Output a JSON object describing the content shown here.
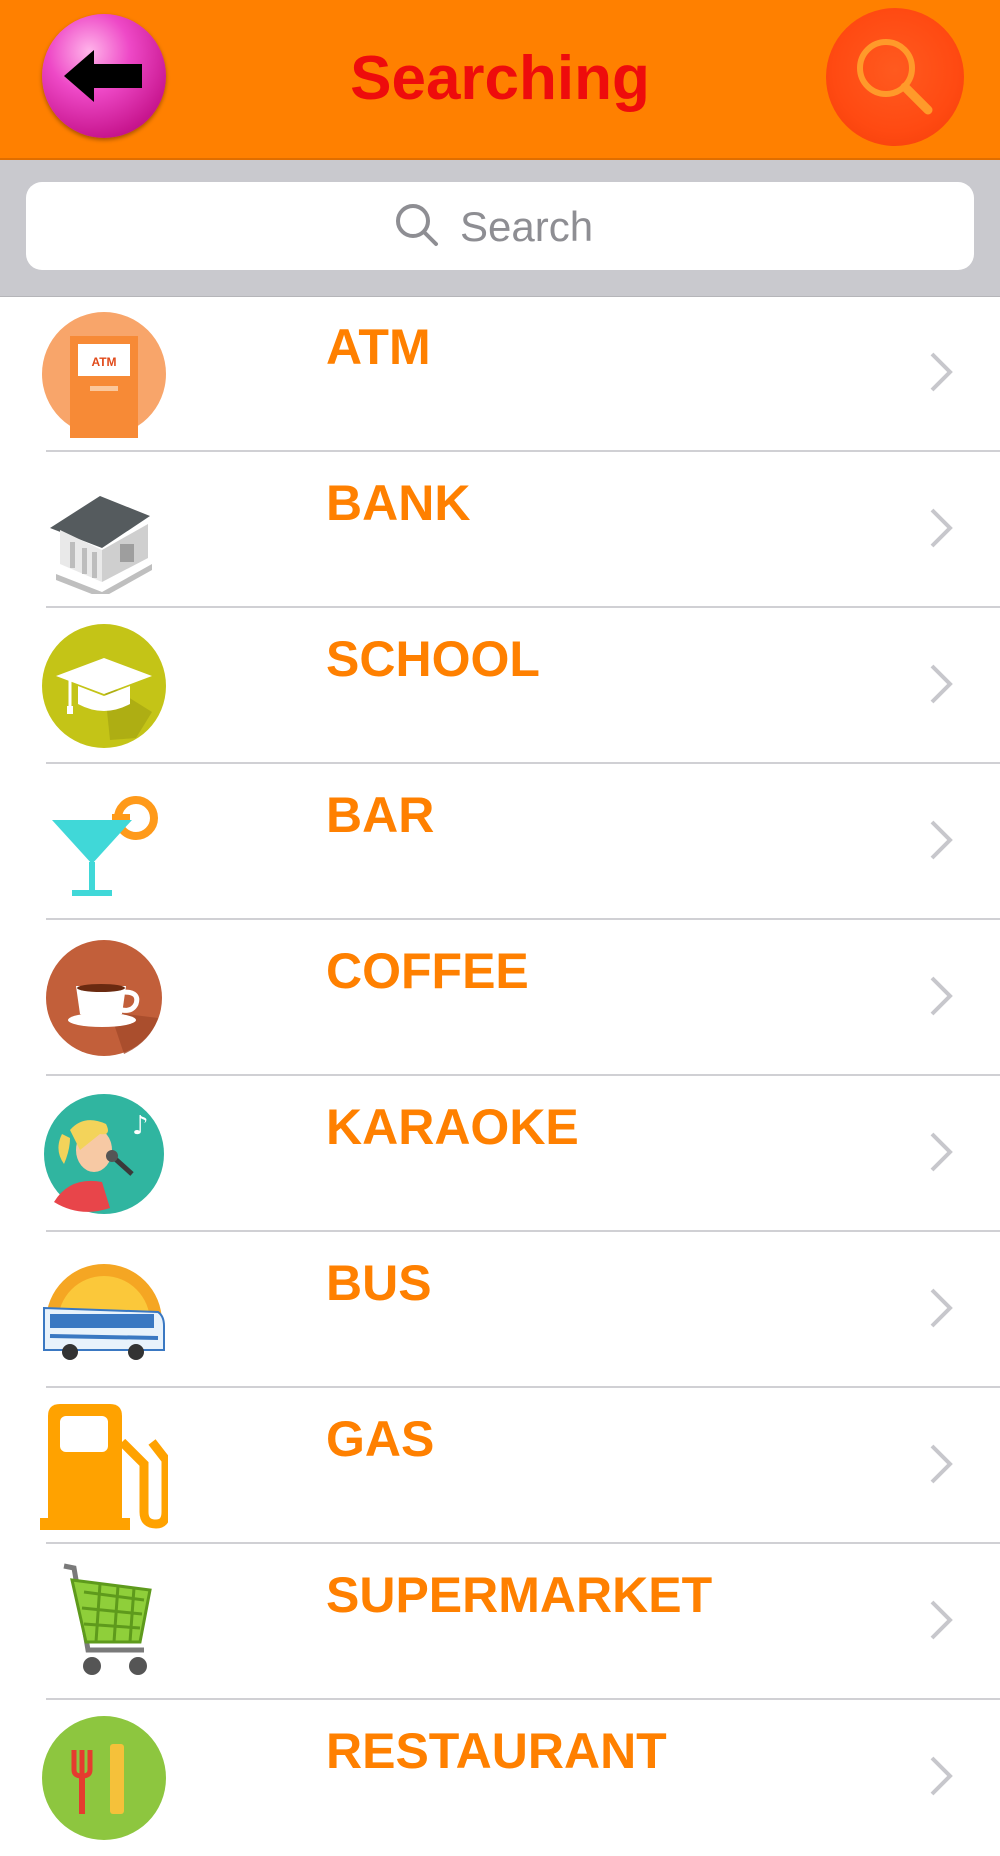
{
  "header": {
    "title": "Searching",
    "back_icon": "back-arrow-icon",
    "search_icon": "search-icon"
  },
  "search": {
    "placeholder": "Search",
    "value": ""
  },
  "categories": [
    {
      "label": "ATM",
      "icon": "atm-icon"
    },
    {
      "label": "BANK",
      "icon": "bank-icon"
    },
    {
      "label": "SCHOOL",
      "icon": "graduation-cap-icon"
    },
    {
      "label": "BAR",
      "icon": "cocktail-icon"
    },
    {
      "label": "COFFEE",
      "icon": "coffee-cup-icon"
    },
    {
      "label": "KARAOKE",
      "icon": "karaoke-singer-icon"
    },
    {
      "label": "BUS",
      "icon": "bus-icon"
    },
    {
      "label": "GAS",
      "icon": "gas-pump-icon"
    },
    {
      "label": "SUPERMARKET",
      "icon": "shopping-cart-icon"
    },
    {
      "label": "RESTAURANT",
      "icon": "restaurant-icon"
    }
  ],
  "atm_icon_text": "ATM",
  "colors": {
    "navbar": "#ff8000",
    "title": "#ee0c0c",
    "label": "#ff8000",
    "search_bar_bg": "#c9c9ce"
  }
}
